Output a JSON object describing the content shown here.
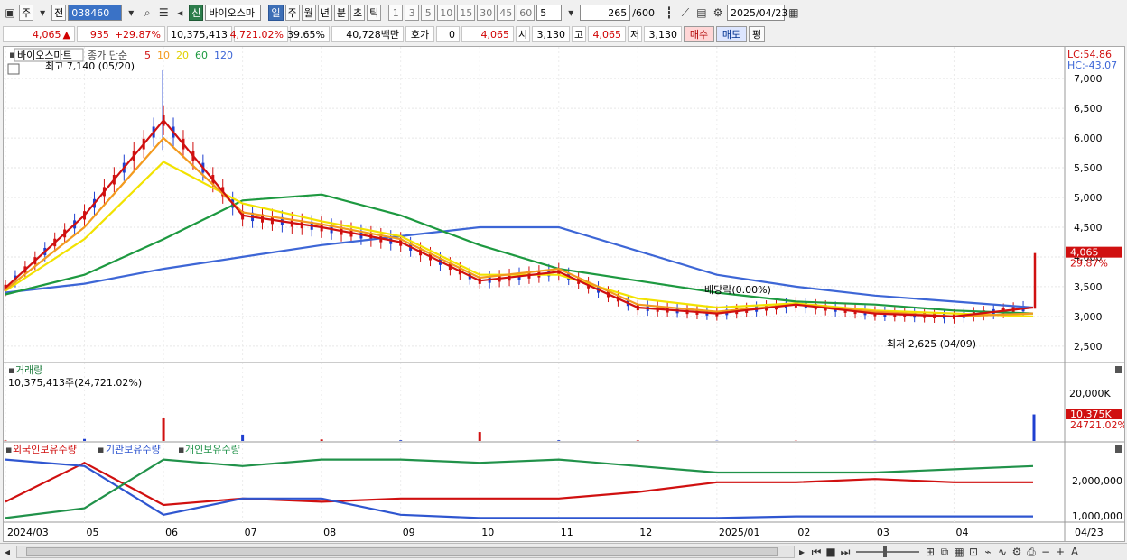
{
  "toolbar": {
    "market_type": "주",
    "prefix": "전",
    "stock_code": "038460",
    "new_badge": "신",
    "stock_name": "바이오스마",
    "periods": [
      "일",
      "주",
      "월",
      "년",
      "분",
      "초",
      "틱"
    ],
    "active_period": "일",
    "intervals": [
      "1",
      "3",
      "5",
      "10",
      "15",
      "30",
      "45",
      "60"
    ],
    "count_value": "5",
    "range_display": "265",
    "range_total": "/600",
    "date": "2025/04/23"
  },
  "quote": {
    "price": "4,065",
    "price_arrow": "▲",
    "change": "935",
    "change_pct": "+29.87%",
    "volume": "10,375,413",
    "volume_pct": "4,721.02%",
    "turnover": "39.65%",
    "amount": "40,728백만",
    "hoga_label": "호가",
    "hoga_value": "0",
    "hoga_price": "4,065",
    "open_label": "시",
    "open_value": "3,130",
    "high_label": "고",
    "high_value": "4,065",
    "low_label": "저",
    "low_value": "3,130",
    "buy_label": "매수",
    "sell_label": "매도",
    "eval_label": "평"
  },
  "price_panel": {
    "stock_label": "바이오스마트",
    "legend_prefix": "종가 단순",
    "ma_periods": [
      "5",
      "10",
      "20",
      "60",
      "120"
    ],
    "ma_colors": [
      "#d01010",
      "#f39a1e",
      "#f2e200",
      "#1d9940",
      "#3d66d6"
    ],
    "high_annotation": "최고 7,140 (05/20)",
    "low_annotation": "최저 2,625 (04/09)",
    "dividend_annotation": "배당락(0.00%)",
    "lc_label": "LC:54.86",
    "hc_label": "HC:-43.07",
    "current_price_tag": "4,065",
    "current_pct_tag": "29.87%",
    "y_ticks": [
      "7,000",
      "6,500",
      "6,000",
      "5,500",
      "5,000",
      "4,500",
      "4,000",
      "3,500",
      "3,000",
      "2,500"
    ]
  },
  "volume_panel": {
    "title": "거래량",
    "current": "10,375,413주(24,721.02%)",
    "y_tick": "20,000K",
    "current_tag": "10,375K",
    "current_pct_tag": "24721.02%"
  },
  "holdings_panel": {
    "series_names": [
      "외국인보유수량",
      "기관보유수량",
      "개인보유수량"
    ],
    "series_colors": [
      "#d01010",
      "#2f56d0",
      "#21924a"
    ],
    "y_ticks": [
      "2,000,000",
      "1,000,000"
    ]
  },
  "x_axis": {
    "labels": [
      "2024/03",
      "05",
      "06",
      "07",
      "08",
      "09",
      "10",
      "11",
      "12",
      "2025/01",
      "02",
      "03",
      "04"
    ],
    "right_label": "04/23"
  },
  "chart_data": {
    "type": "line",
    "title": "",
    "x": [
      "2024/03",
      "04",
      "05",
      "06",
      "07",
      "08",
      "09",
      "10",
      "11",
      "12",
      "2025/01",
      "02",
      "03",
      "04"
    ],
    "series": [
      {
        "name": "5",
        "values": [
          3480,
          4700,
          6300,
          4700,
          4500,
          4250,
          3600,
          3750,
          3150,
          3050,
          3200,
          3050,
          3000,
          3150
        ]
      },
      {
        "name": "10",
        "values": [
          3450,
          4500,
          6000,
          4750,
          4550,
          4300,
          3650,
          3800,
          3200,
          3080,
          3200,
          3080,
          3000,
          3050
        ]
      },
      {
        "name": "20",
        "values": [
          3430,
          4300,
          5600,
          4900,
          4600,
          4350,
          3700,
          3700,
          3300,
          3150,
          3220,
          3100,
          3050,
          3000
        ]
      },
      {
        "name": "60",
        "values": [
          3370,
          3700,
          4300,
          4950,
          5050,
          4700,
          4200,
          3800,
          3600,
          3400,
          3250,
          3200,
          3100,
          3050
        ]
      },
      {
        "name": "120",
        "values": [
          3400,
          3550,
          3800,
          4000,
          4200,
          4350,
          4500,
          4500,
          4100,
          3700,
          3500,
          3350,
          3250,
          3150
        ]
      }
    ],
    "candles_summary": {
      "high": 7140,
      "high_date": "05/20",
      "low": 2625,
      "low_date": "04/09",
      "last": 4065,
      "last_open": 3130
    },
    "ylim": [
      2300,
      7200
    ],
    "volume_k": [
      200,
      800,
      9000,
      2500,
      600,
      300,
      3500,
      300,
      200,
      100,
      100,
      60,
      50,
      10375
    ],
    "holdings": {
      "외국인보유수량": [
        1400000,
        2600000,
        1300000,
        1500000,
        1400000,
        1500000,
        1500000,
        1500000,
        1700000,
        2000000,
        2000000,
        2100000,
        2000000,
        2000000
      ],
      "기관보유수량": [
        2700000,
        2500000,
        1000000,
        1500000,
        1500000,
        1000000,
        900000,
        900000,
        900000,
        900000,
        950000,
        950000,
        950000,
        950000
      ],
      "개인보유수량": [
        900000,
        1200000,
        2700000,
        2500000,
        2700000,
        2700000,
        2600000,
        2700000,
        2500000,
        2300000,
        2300000,
        2300000,
        2400000,
        2500000
      ]
    },
    "ylabel": "",
    "xlabel": "",
    "grid": true,
    "legend": "top-left"
  }
}
